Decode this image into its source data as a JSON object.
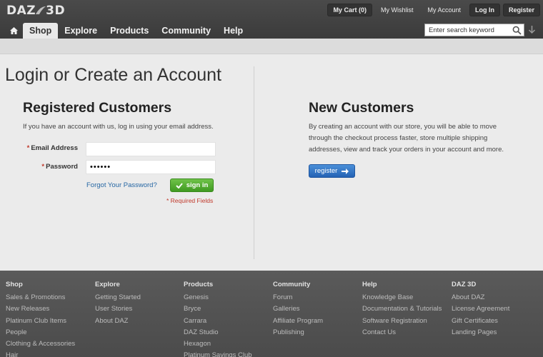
{
  "header": {
    "logo_text": "DAZ 3D",
    "top_links": [
      "My Cart (0)",
      "My Wishlist",
      "My Account",
      "Log In",
      "Register"
    ],
    "nav": [
      "Shop",
      "Explore",
      "Products",
      "Community",
      "Help"
    ],
    "active_nav": "Shop",
    "search_placeholder": "Enter search keyword"
  },
  "main": {
    "page_title": "Login or Create an Account",
    "registered": {
      "title": "Registered Customers",
      "intro": "If you have an account with us, log in using your email address.",
      "email_label": "Email Address",
      "email_value": "",
      "password_label": "Password",
      "password_value": "••••••",
      "required_marker": "*",
      "forgot_link": "Forgot Your Password?",
      "signin_label": "sign in",
      "required_note": "* Required Fields"
    },
    "new_customers": {
      "title": "New Customers",
      "intro": "By creating an account with our store, you will be able to move through the checkout process faster, store multiple shipping addresses, view and track your orders in your account and more.",
      "register_label": "register"
    }
  },
  "footer": {
    "columns": [
      {
        "title": "Shop",
        "links": [
          "Sales & Promotions",
          "New Releases",
          "Platinum Club Items",
          "People",
          "Clothing & Accessories",
          "Hair"
        ]
      },
      {
        "title": "Explore",
        "links": [
          "Getting Started",
          "User Stories",
          "About DAZ"
        ]
      },
      {
        "title": "Products",
        "links": [
          "Genesis",
          "Bryce",
          "Carrara",
          "DAZ Studio",
          "Hexagon",
          "Platinum Savings Club"
        ]
      },
      {
        "title": "Community",
        "links": [
          "Forum",
          "Galleries",
          "Affiliate Program",
          "Publishing"
        ]
      },
      {
        "title": "Help",
        "links": [
          "Knowledge Base",
          "Documentation & Tutorials",
          "Software Registration",
          "Contact Us"
        ]
      },
      {
        "title": "DAZ 3D",
        "links": [
          "About DAZ",
          "License Agreement",
          "Gift Certificates",
          "Landing Pages"
        ]
      }
    ]
  },
  "colors": {
    "header_bg": "#3f3f3f",
    "link_blue": "#2667a4",
    "signin_green": "#4ea82d",
    "register_blue": "#2f74c6",
    "required_red": "#c0392b"
  },
  "icons": [
    "home-icon",
    "search-icon",
    "download-icon",
    "checkmark-icon",
    "arrow-right-icon"
  ]
}
